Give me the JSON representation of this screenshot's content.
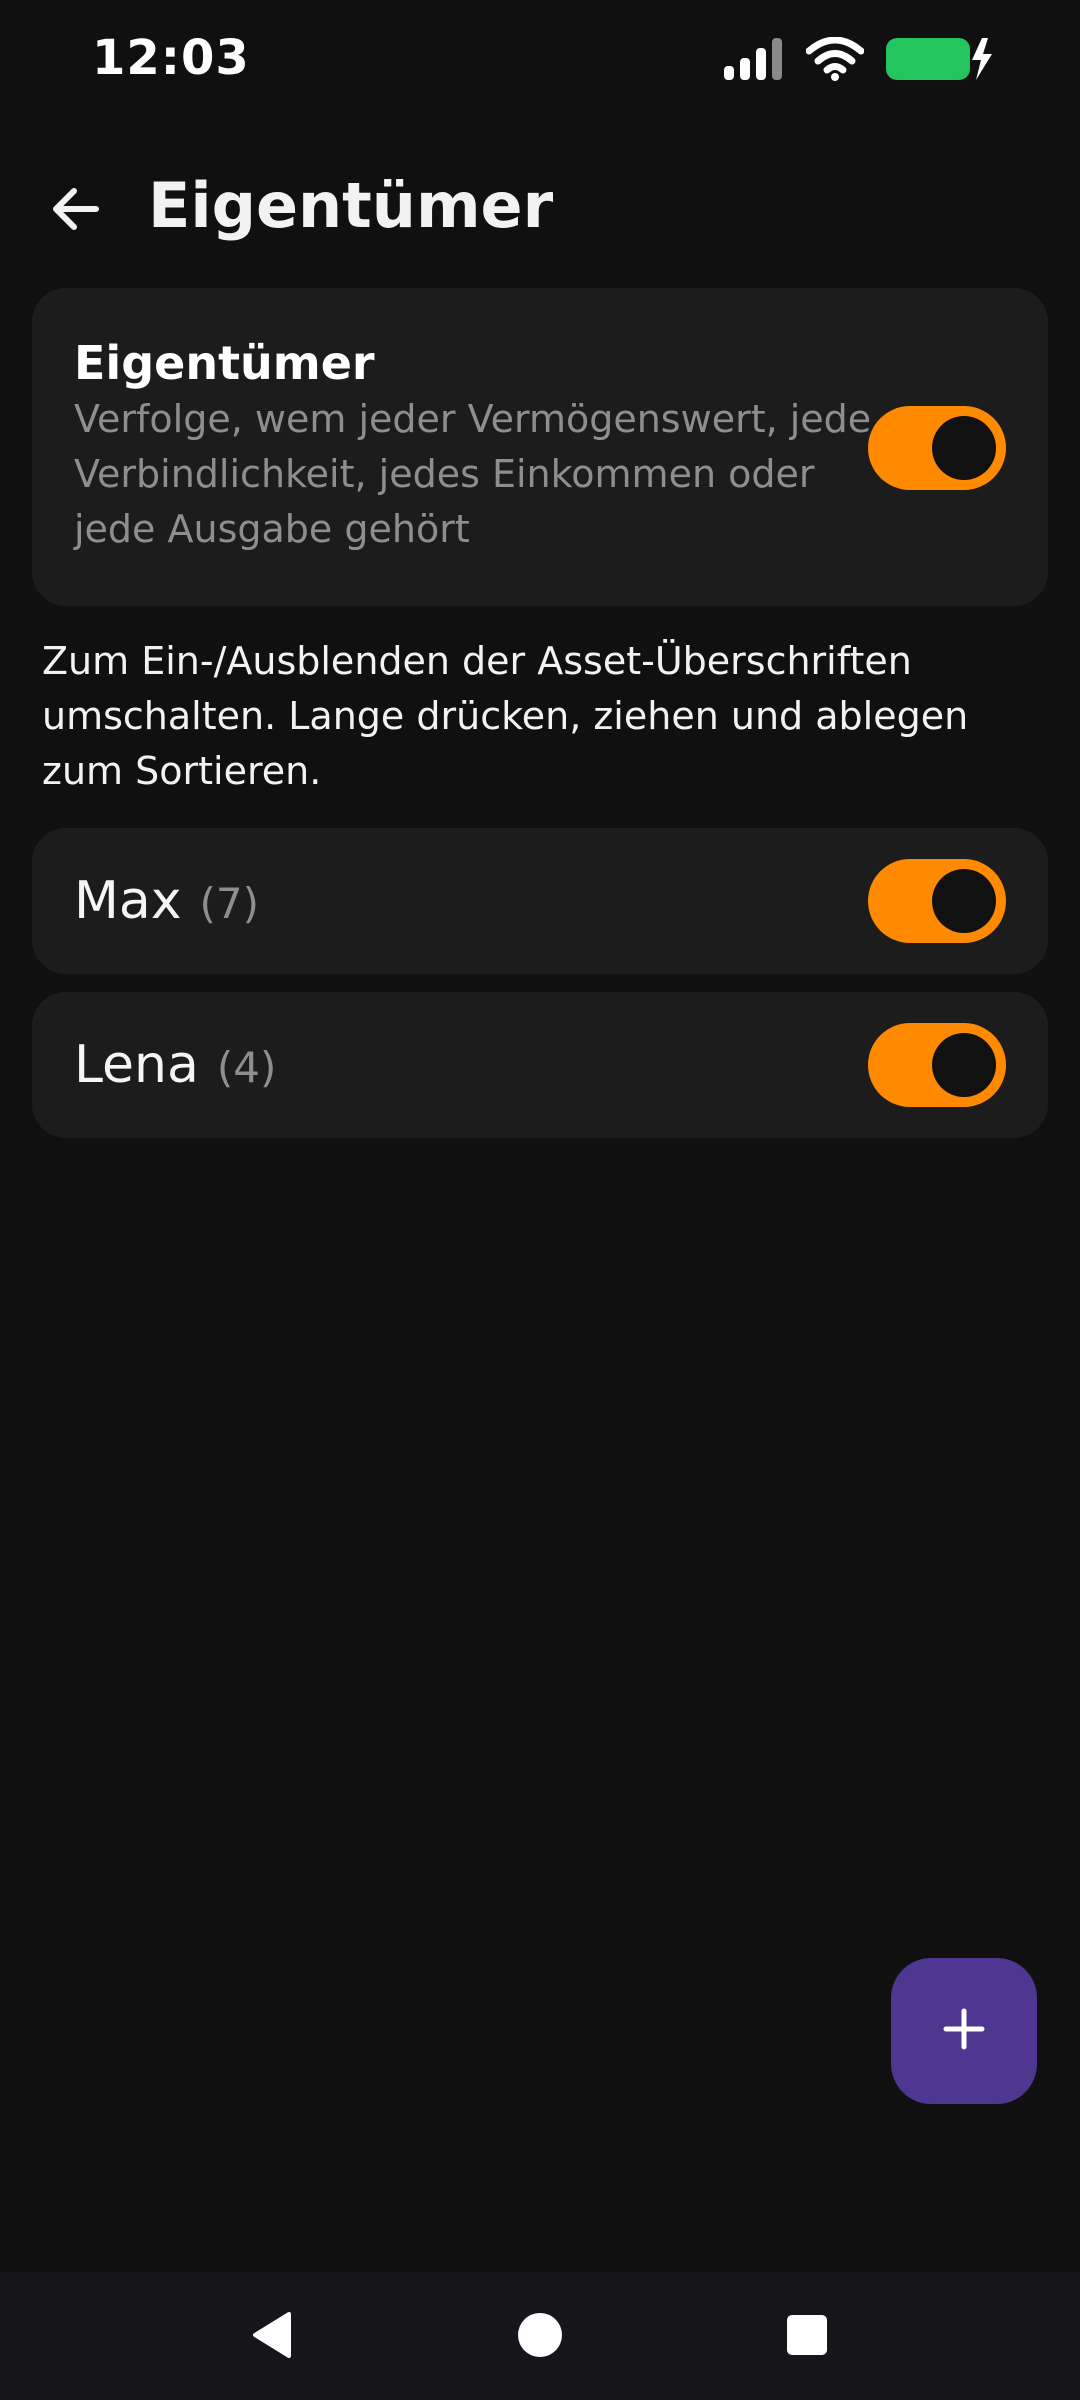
{
  "status_bar": {
    "time": "12:03",
    "icons": [
      "signal-icon",
      "wifi-icon",
      "battery-charging-icon"
    ],
    "battery_color": "#22c55e"
  },
  "app_bar": {
    "title": "Eigentümer",
    "back_icon": "arrow-left-icon"
  },
  "main_card": {
    "title": "Eigentümer",
    "description": "Verfolge, wem jeder Vermögenswert, jede Verbindlichkeit, jedes Einkommen oder jede Ausgabe gehört",
    "toggle_on": true
  },
  "hint": "Zum Ein-/Ausblenden der Asset-Überschriften umschalten. Lange drücken, ziehen und ablegen zum Sortieren.",
  "owners": [
    {
      "name": "Max",
      "count": "(7)",
      "toggle_on": true
    },
    {
      "name": "Lena",
      "count": "(4)",
      "toggle_on": true
    }
  ],
  "fab": {
    "icon": "plus-icon"
  },
  "nav_bar": {
    "icons": [
      "back-triangle-icon",
      "home-circle-icon",
      "recents-square-icon"
    ]
  },
  "colors": {
    "background": "#101011",
    "card": "#1c1c1d",
    "accent_toggle": "#ff8a00",
    "fab": "#4f3690",
    "secondary_text": "#8e8e90"
  }
}
